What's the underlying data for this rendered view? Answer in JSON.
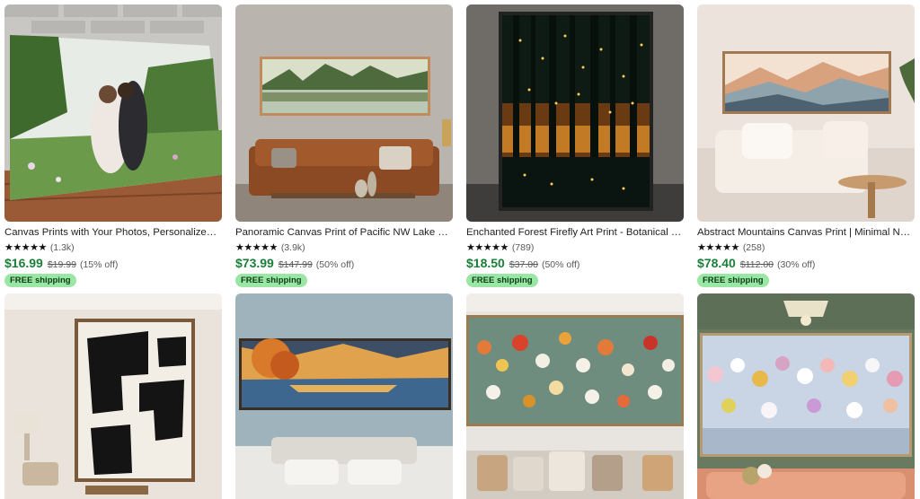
{
  "listings_row1": [
    {
      "title": "Canvas Prints with Your Photos, Personalized Pic...",
      "stars": "★★★★★",
      "count": "(1.3k)",
      "price": "$16.99",
      "orig": "$19.99",
      "disc": "(15% off)",
      "ship": "FREE shipping"
    },
    {
      "title": "Panoramic Canvas Print of Pacific NW Lake & For...",
      "stars": "★★★★★",
      "count": "(3.9k)",
      "price": "$73.99",
      "orig": "$147.99",
      "disc": "(50% off)",
      "ship": "FREE shipping"
    },
    {
      "title": "Enchanted Forest Firefly Art Print - Botanical Wal...",
      "stars": "★★★★★",
      "count": "(789)",
      "price": "$18.50",
      "orig": "$37.00",
      "disc": "(50% off)",
      "ship": "FREE shipping"
    },
    {
      "title": "Abstract Mountains Canvas Print | Minimal Neutr...",
      "stars": "★★★★★",
      "count": "(258)",
      "price": "$78.40",
      "orig": "$112.00",
      "disc": "(30% off)",
      "ship": "FREE shipping"
    }
  ],
  "images": [
    "couple-photo-canvas-image",
    "lake-forest-panorama-image",
    "firefly-forest-image",
    "abstract-mountains-image",
    "black-white-abstract-image",
    "autumn-lake-painting-image",
    "wildflower-painting-image",
    "pastel-flowers-painting-image"
  ],
  "colors": {
    "price": "#1a7f37",
    "ship_badge": "#9ae6a5"
  }
}
